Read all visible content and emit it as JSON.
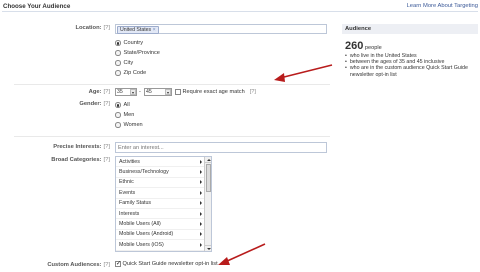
{
  "header": {
    "title": "Choose Your Audience",
    "learn_more": "Learn More About Targeting"
  },
  "location": {
    "label": "Location:",
    "help": "[?]",
    "token": "United States",
    "options": [
      "Country",
      "State/Province",
      "City",
      "Zip Code"
    ],
    "selected": "Country"
  },
  "age": {
    "label": "Age:",
    "help": "[?]",
    "min": "35",
    "dash": "-",
    "max": "45",
    "exact_label": "Require exact age match",
    "exact_help": "[?]"
  },
  "gender": {
    "label": "Gender:",
    "help": "[?]",
    "options": [
      "All",
      "Men",
      "Women"
    ],
    "selected": "All"
  },
  "interests": {
    "label": "Precise Interests:",
    "help": "[?]",
    "placeholder": "Enter an interest..."
  },
  "categories": {
    "label": "Broad Categories:",
    "help": "[?]",
    "items": [
      "Activities",
      "Business/Technology",
      "Ethnic",
      "Events",
      "Family Status",
      "Interests",
      "Mobile Users (All)",
      "Mobile Users (Android)",
      "Mobile Users (iOS)"
    ]
  },
  "custom": {
    "label": "Custom Audiences:",
    "help": "[?]",
    "option": "Quick Start Guide newsletter opt-in list",
    "checked": true
  },
  "audience": {
    "heading": "Audience",
    "count": "260",
    "unit": "people",
    "bullets": [
      "who live in the United States",
      "between the ages of 35 and 45 inclusive",
      "who are in the custom audience Quick Start Guide newsletter opt-in list"
    ]
  },
  "colors": {
    "link": "#3b5998",
    "arrow": "#b81c1c",
    "panel_header": "#edeff4"
  }
}
